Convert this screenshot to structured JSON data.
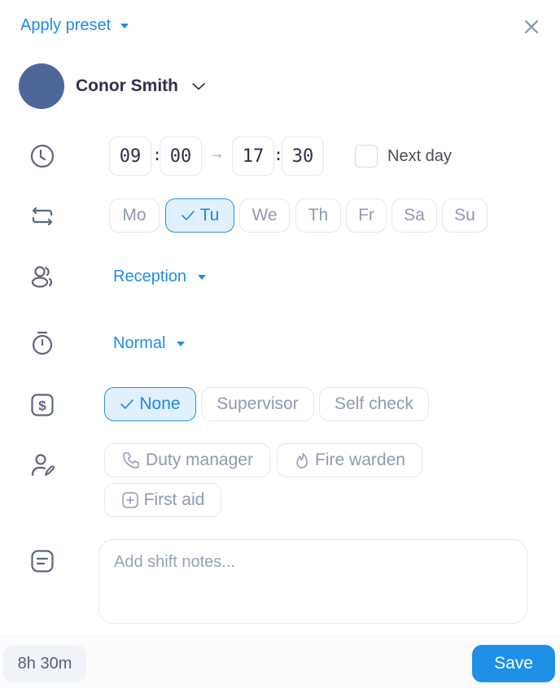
{
  "header": {
    "preset_label": "Apply preset",
    "close_icon": "close-icon"
  },
  "user": {
    "name": "Conor Smith",
    "avatar_color": "#4d6898"
  },
  "time": {
    "start_hour": "09",
    "start_minute": "00",
    "end_hour": "17",
    "end_minute": "30",
    "separator": ":",
    "arrow": "→",
    "next_day_label": "Next day",
    "next_day_checked": false
  },
  "repeat": {
    "days": [
      {
        "label": "Mo",
        "selected": false
      },
      {
        "label": "Tu",
        "selected": true
      },
      {
        "label": "We",
        "selected": false
      },
      {
        "label": "Th",
        "selected": false
      },
      {
        "label": "Fr",
        "selected": false
      },
      {
        "label": "Sa",
        "selected": false
      },
      {
        "label": "Su",
        "selected": false
      }
    ]
  },
  "position": {
    "value": "Reception"
  },
  "break": {
    "value": "Normal"
  },
  "pay_check": {
    "options": [
      {
        "label": "None",
        "selected": true
      },
      {
        "label": "Supervisor",
        "selected": false
      },
      {
        "label": "Self check",
        "selected": false
      }
    ]
  },
  "roles": {
    "options": [
      {
        "label": "Duty manager",
        "icon": "phone-icon"
      },
      {
        "label": "Fire warden",
        "icon": "flame-icon"
      },
      {
        "label": "First aid",
        "icon": "plus-square-icon"
      }
    ]
  },
  "notes": {
    "placeholder": "Add shift notes...",
    "value": ""
  },
  "footer": {
    "duration": "8h 30m",
    "save_label": "Save"
  },
  "colors": {
    "accent": "#1e8ce8",
    "chip_border": "#e2e8f0",
    "chip_active_bg": "#e0f0fd",
    "icon": "#5a6780"
  }
}
